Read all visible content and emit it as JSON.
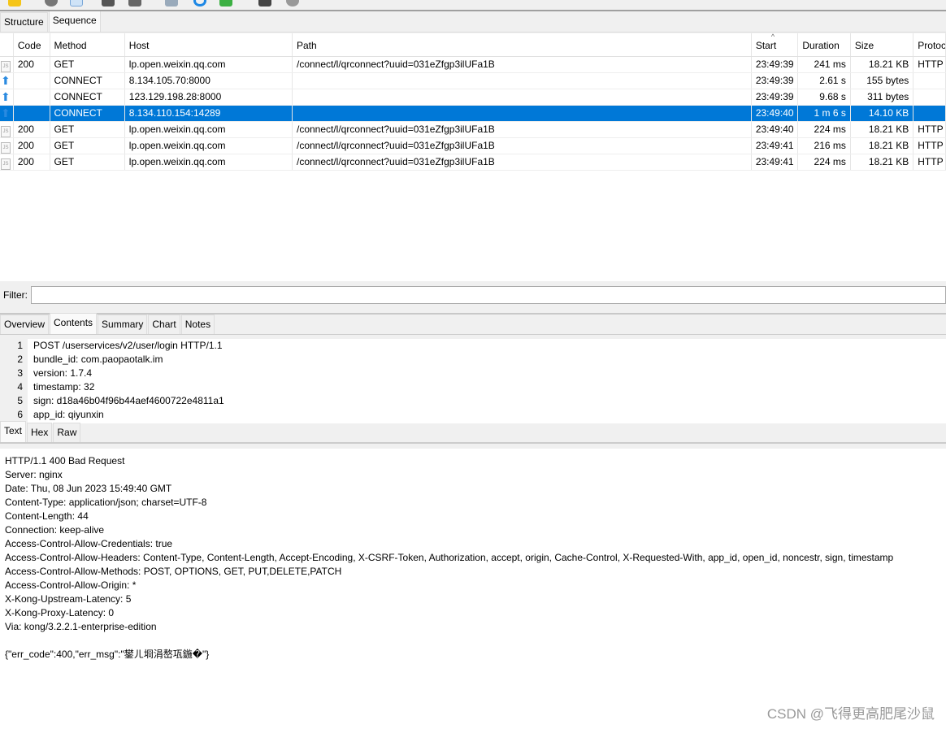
{
  "tabs": [
    "Structure",
    "Sequence"
  ],
  "columns": [
    "",
    "Code",
    "Method",
    "Host",
    "Path",
    "Start",
    "Duration",
    "Size",
    "Protocol"
  ],
  "rows": [
    {
      "icon": "js-file-icon",
      "code": "200",
      "method": "GET",
      "host": "lp.open.weixin.qq.com",
      "path": "/connect/l/qrconnect?uuid=031eZfgp3ilUFa1B",
      "start": "23:49:39",
      "duration": "241 ms",
      "size": "18.21 KB",
      "protocol": "HTTP"
    },
    {
      "icon": "upload-arrow-icon",
      "code": "",
      "method": "CONNECT",
      "host": "8.134.105.70:8000",
      "path": "",
      "start": "23:49:39",
      "duration": "2.61 s",
      "size": "155 bytes",
      "protocol": ""
    },
    {
      "icon": "upload-arrow-icon",
      "code": "",
      "method": "CONNECT",
      "host": "123.129.198.28:8000",
      "path": "",
      "start": "23:49:39",
      "duration": "9.68 s",
      "size": "311 bytes",
      "protocol": ""
    },
    {
      "icon": "upload-arrow-icon",
      "code": "",
      "method": "CONNECT",
      "host": "8.134.110.154:14289",
      "path": "",
      "start": "23:49:40",
      "duration": "1 m 6 s",
      "size": "14.10 KB",
      "protocol": "",
      "selected": true
    },
    {
      "icon": "js-file-icon",
      "code": "200",
      "method": "GET",
      "host": "lp.open.weixin.qq.com",
      "path": "/connect/l/qrconnect?uuid=031eZfgp3ilUFa1B",
      "start": "23:49:40",
      "duration": "224 ms",
      "size": "18.21 KB",
      "protocol": "HTTP"
    },
    {
      "icon": "js-file-icon",
      "code": "200",
      "method": "GET",
      "host": "lp.open.weixin.qq.com",
      "path": "/connect/l/qrconnect?uuid=031eZfgp3ilUFa1B",
      "start": "23:49:41",
      "duration": "216 ms",
      "size": "18.21 KB",
      "protocol": "HTTP"
    },
    {
      "icon": "js-file-icon",
      "code": "200",
      "method": "GET",
      "host": "lp.open.weixin.qq.com",
      "path": "/connect/l/qrconnect?uuid=031eZfgp3ilUFa1B",
      "start": "23:49:41",
      "duration": "224 ms",
      "size": "18.21 KB",
      "protocol": "HTTP"
    }
  ],
  "filter": {
    "label": "Filter:",
    "value": ""
  },
  "detail_tabs": [
    "Overview",
    "Contents",
    "Summary",
    "Chart",
    "Notes"
  ],
  "request_lines": [
    "POST /userservices/v2/user/login HTTP/1.1",
    "bundle_id: com.paopaotalk.im",
    "version: 1.7.4",
    "timestamp: 32",
    "sign: d18a46b04f96b44aef4600722e4811a1",
    "app_id: qiyunxin"
  ],
  "view_tabs": [
    "Text",
    "Hex",
    "Raw"
  ],
  "response_lines": [
    "HTTP/1.1 400 Bad Request",
    "Server: nginx",
    "Date: Thu, 08 Jun 2023 15:49:40 GMT",
    "Content-Type: application/json; charset=UTF-8",
    "Content-Length: 44",
    "Connection: keep-alive",
    "Access-Control-Allow-Credentials: true",
    "Access-Control-Allow-Headers: Content-Type, Content-Length, Accept-Encoding, X-CSRF-Token, Authorization, accept, origin, Cache-Control, X-Requested-With, app_id, open_id, noncestr, sign, timestamp",
    "Access-Control-Allow-Methods: POST, OPTIONS, GET, PUT,DELETE,PATCH",
    "Access-Control-Allow-Origin: *",
    "X-Kong-Upstream-Latency: 5",
    "X-Kong-Proxy-Latency: 0",
    "Via: kong/3.2.2.1-enterprise-edition",
    "",
    "{\"err_code\":400,\"err_msg\":\"鐢ㄦ埛涓嶅瓨鍦�\"}"
  ],
  "watermark": "CSDN @飞得更高肥尾沙鼠",
  "colors": {
    "selection": "#0078d7"
  }
}
